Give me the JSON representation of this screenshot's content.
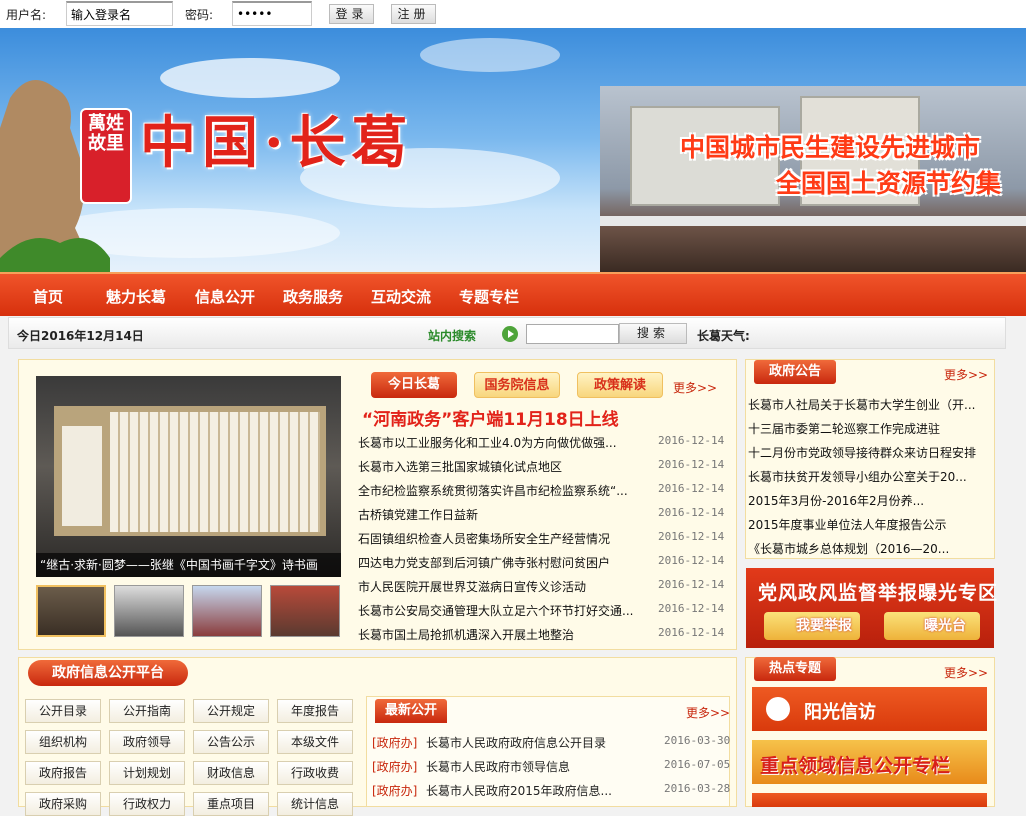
{
  "login": {
    "username_label": "用户名:",
    "username_value": "输入登录名",
    "password_label": "密码:",
    "password_value": "•••••",
    "login_btn": "登录",
    "register_btn": "注册"
  },
  "banner": {
    "seal": "萬姓故里",
    "title": "中国·长葛",
    "slogan1": "中国城市民生建设先进城市",
    "slogan2": "全国国土资源节约集"
  },
  "nav": [
    "首页",
    "魅力长葛",
    "信息公开",
    "政务服务",
    "互动交流",
    "专题专栏"
  ],
  "datebar": {
    "date": "今日2016年12月14日",
    "search_label": "站内搜索",
    "search_btn": "搜索",
    "weather": "长葛天气:"
  },
  "news": {
    "tabs": [
      "今日长葛",
      "国务院信息",
      "政策解读"
    ],
    "more": "更多>>",
    "headline": "“河南政务”客户端11月18日上线",
    "caption": "“继古·求新·圆梦——张继《中国书画千字文》诗书画",
    "items": [
      {
        "title": "长葛市以工业服务化和工业4.0为方向做优做强...",
        "date": "2016-12-14"
      },
      {
        "title": "长葛市入选第三批国家城镇化试点地区",
        "date": "2016-12-14"
      },
      {
        "title": "全市纪检监察系统贯彻落实许昌市纪检监察系统“...",
        "date": "2016-12-14"
      },
      {
        "title": "古桥镇党建工作日益新",
        "date": "2016-12-14"
      },
      {
        "title": "石固镇组织检查人员密集场所安全生产经营情况",
        "date": "2016-12-14"
      },
      {
        "title": "四达电力党支部到后河镇广佛寺张村慰问贫困户",
        "date": "2016-12-14"
      },
      {
        "title": "市人民医院开展世界艾滋病日宣传义诊活动",
        "date": "2016-12-14"
      },
      {
        "title": "长葛市公安局交通管理大队立足六个环节打好交通...",
        "date": "2016-12-14"
      },
      {
        "title": "长葛市国土局抢抓机遇深入开展土地整治",
        "date": "2016-12-14"
      }
    ]
  },
  "notice": {
    "title": "政府公告",
    "more": "更多>>",
    "items": [
      "长葛市人社局关于长葛市大学生创业（开...",
      "十三届市委第二轮巡察工作完成进驻",
      "十二月份市党政领导接待群众来访日程安排",
      "长葛市扶贫开发领导小组办公室关于20...",
      "2015年3月份-2016年2月份养...",
      "2015年度事业单位法人年度报告公示",
      "《长葛市城乡总体规划（2016—20..."
    ]
  },
  "report": {
    "title": "党风政风监督举报曝光专区",
    "btn1": "我要举报",
    "btn2": "曝光台"
  },
  "govinfo": {
    "title": "政府信息公开平台",
    "buttons": [
      "公开目录",
      "公开指南",
      "公开规定",
      "年度报告",
      "组织机构",
      "政府领导",
      "公告公示",
      "本级文件",
      "政府报告",
      "计划规划",
      "财政信息",
      "行政收费",
      "政府采购",
      "行政权力",
      "重点项目",
      "统计信息"
    ],
    "latest_title": "最新公开",
    "more": "更多>>",
    "latest": [
      {
        "tag": "[政府办]",
        "title": "长葛市人民政府政府信息公开目录",
        "date": "2016-03-30"
      },
      {
        "tag": "[政府办]",
        "title": "长葛市人民政府市领导信息",
        "date": "2016-07-05"
      },
      {
        "tag": "[政府办]",
        "title": "长葛市人民政府2015年政府信息...",
        "date": "2016-03-28"
      }
    ]
  },
  "hot": {
    "title": "热点专题",
    "more": "更多>>",
    "item1": "阳光信访",
    "item2": "重点领域信息公开专栏"
  },
  "colors": {
    "brand_red": "#d7300d",
    "panel_bg": "#fffbe8"
  }
}
